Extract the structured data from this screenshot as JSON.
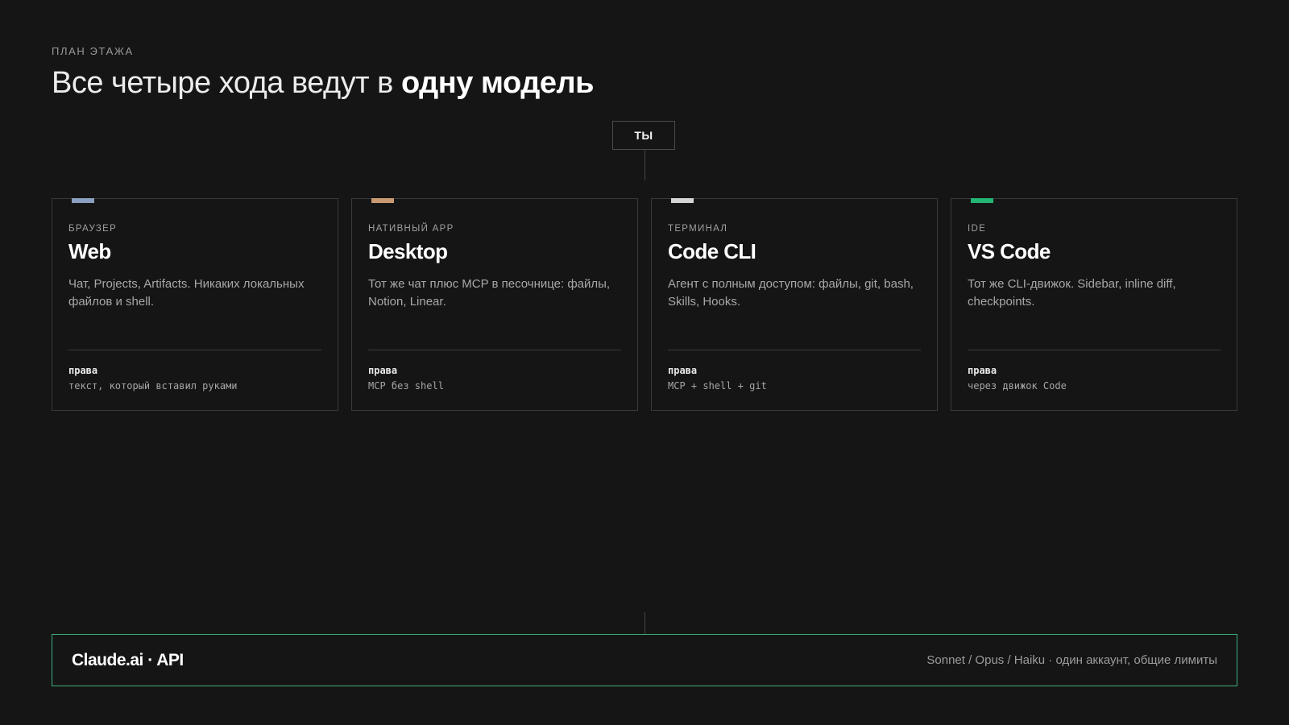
{
  "header": {
    "eyebrow": "ПЛАН ЭТАЖА",
    "title_light": "Все четыре хода ведут в",
    "title_bold": "одну модель"
  },
  "user_node": {
    "label": "ТЫ"
  },
  "cards": [
    {
      "eyebrow": "БРАУЗЕР",
      "title": "Web",
      "description": "Чат, Projects, Artifacts. Никаких локальных файлов и shell.",
      "perm_label": "права",
      "perm_value": "текст, который вставил руками",
      "accent_color": "#8a9fc0"
    },
    {
      "eyebrow": "НАТИВНЫЙ APP",
      "title": "Desktop",
      "description": "Тот же чат плюс MCP в песочнице: файлы, Notion, Linear.",
      "perm_label": "права",
      "perm_value": "MCP без shell",
      "accent_color": "#c99a72"
    },
    {
      "eyebrow": "ТЕРМИНАЛ",
      "title": "Code CLI",
      "description": "Агент с полным доступом: файлы, git, bash, Skills, Hooks.",
      "perm_label": "права",
      "perm_value": "MCP + shell + git",
      "accent_color": "#d4d4d4"
    },
    {
      "eyebrow": "IDE",
      "title": "VS Code",
      "description": "Тот же CLI-движок. Sidebar, inline diff, checkpoints.",
      "perm_label": "права",
      "perm_value": "через движок Code",
      "accent_color": "#22b573"
    }
  ],
  "footer": {
    "title": "Claude.ai · API",
    "note": "Sonnet / Opus / Haiku · один аккаунт, общие лимиты",
    "border_color": "#3fae7d"
  }
}
